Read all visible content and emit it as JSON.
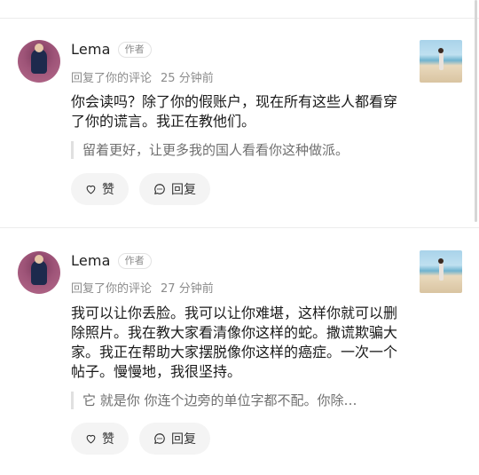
{
  "comments": [
    {
      "username": "Lema",
      "badge": "作者",
      "action": "回复了你的评论",
      "time": "25 分钟前",
      "body": "你会读吗？除了你的假账户，现在所有这些人都看穿了你的谎言。我正在教他们。",
      "quote": "留着更好，让更多我的国人看看你这种做派。",
      "like_label": "赞",
      "reply_label": "回复"
    },
    {
      "username": "Lema",
      "badge": "作者",
      "action": "回复了你的评论",
      "time": "27 分钟前",
      "body": "我可以让你丢脸。我可以让你难堪，这样你就可以删除照片。我在教大家看清像你这样的蛇。撒谎欺骗大家。我正在帮助大家摆脱像你这样的癌症。一次一个帖子。慢慢地，我很坚持。",
      "quote": "它 就是你 你连个边旁的单位字都不配。你除…",
      "like_label": "赞",
      "reply_label": "回复"
    }
  ],
  "icons": {
    "avatar": "user-avatar",
    "thumbnail": "beach-photo-thumbnail",
    "like": "heart-icon",
    "reply": "comment-bubble-icon"
  }
}
